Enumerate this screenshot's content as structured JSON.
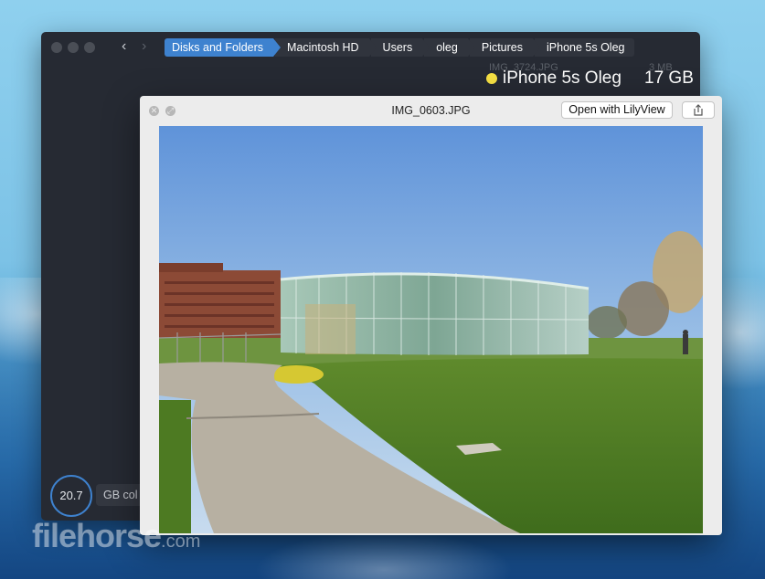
{
  "breadcrumb": [
    "Disks and Folders",
    "Macintosh HD",
    "Users",
    "oleg",
    "Pictures",
    "iPhone 5s Oleg"
  ],
  "device": {
    "name": "iPhone 5s Oleg",
    "size": "17 GB",
    "dot_color": "#f7e244",
    "ghost_file": "IMG_3724.JPG",
    "ghost_size": "3   MB"
  },
  "usage": {
    "value": "20.7",
    "label": "GB col"
  },
  "quicklook": {
    "title": "IMG_0603.JPG",
    "open_button": "Open with LilyView",
    "share_icon": "share-icon",
    "close_icon": "close-icon",
    "fullscreen_icon": "fullscreen-icon"
  },
  "watermark": {
    "main": "filehorse",
    "suffix": ".com"
  },
  "colors": {
    "accent": "#3e82cf",
    "window_bg": "#262a33"
  }
}
